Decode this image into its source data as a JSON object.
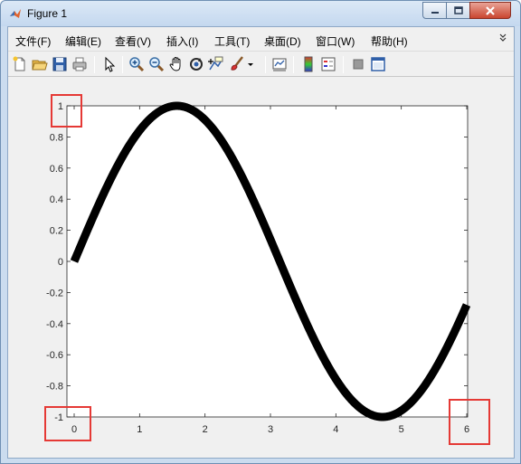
{
  "window": {
    "title": "Figure 1"
  },
  "menu": {
    "items": [
      {
        "label": "文件(F)"
      },
      {
        "label": "编辑(E)"
      },
      {
        "label": "查看(V)"
      },
      {
        "label": "插入(I)"
      },
      {
        "label": "工具(T)"
      },
      {
        "label": "桌面(D)"
      },
      {
        "label": "窗口(W)"
      },
      {
        "label": "帮助(H)"
      }
    ],
    "overflow_icon": "chevron-double-icon"
  },
  "toolbar": {
    "icons": [
      "new-figure-icon",
      "open-file-icon",
      "save-icon",
      "print-icon",
      "edit-plot-arrow-icon",
      "zoom-in-icon",
      "zoom-out-icon",
      "pan-hand-icon",
      "rotate-3d-icon",
      "data-cursor-icon",
      "brush-icon",
      "brush-dropdown-icon",
      "link-plot-icon",
      "insert-colorbar-icon",
      "insert-legend-icon",
      "hide-plot-tools-icon",
      "show-plot-tools-icon"
    ]
  },
  "chart_data": {
    "type": "line",
    "function": "sin(x)",
    "xlim": [
      0,
      6
    ],
    "ylim": [
      -1,
      1
    ],
    "xticks": [
      "0",
      "1",
      "2",
      "3",
      "4",
      "5",
      "6"
    ],
    "yticks": [
      "1",
      "0.8",
      "0.6",
      "0.4",
      "0.2",
      "0",
      "-0.2",
      "-0.4",
      "-0.6",
      "-0.8",
      "-1"
    ],
    "x": [
      0,
      0.25,
      0.5,
      0.75,
      1,
      1.25,
      1.5,
      1.5708,
      1.75,
      2,
      2.25,
      2.5,
      2.75,
      3,
      3.25,
      3.5,
      3.75,
      4,
      4.25,
      4.5,
      4.7124,
      5,
      5.25,
      5.5,
      5.75,
      6
    ],
    "y": [
      0,
      0.247,
      0.479,
      0.682,
      0.841,
      0.949,
      0.997,
      1,
      0.984,
      0.909,
      0.778,
      0.598,
      0.382,
      0.141,
      -0.108,
      -0.351,
      -0.572,
      -0.757,
      -0.895,
      -0.978,
      -1,
      -0.959,
      -0.859,
      -0.706,
      -0.508,
      -0.279
    ],
    "line_color": "#000000",
    "grid": false,
    "legend": "none"
  },
  "highlights": [
    {
      "name": "highlight-ytick-max"
    },
    {
      "name": "highlight-ytick-min"
    },
    {
      "name": "highlight-xtick-max"
    }
  ],
  "colors": {
    "highlight": "#e53935",
    "axes_bg": "#ffffff",
    "figure_bg": "#f0f0f0"
  }
}
